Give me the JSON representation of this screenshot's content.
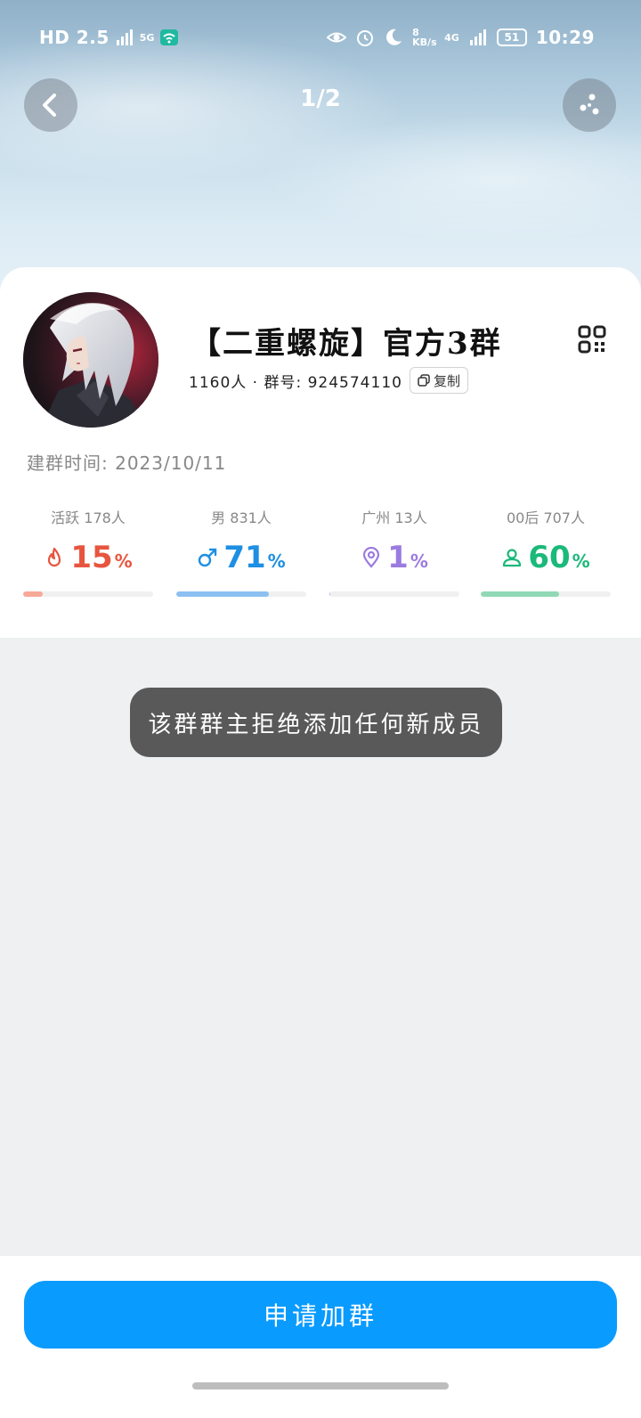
{
  "status_bar": {
    "left_text": "HD 2.5",
    "network_small": "5G",
    "speed": "8 KB/s",
    "signal_label": "4G",
    "battery_text": "51",
    "time": "10:29"
  },
  "nav": {
    "page_indicator": "1/2"
  },
  "group": {
    "name": "【二重螺旋】官方3群",
    "meta": "1160人 · 群号: 924574110",
    "copy_label": "复制",
    "created": "建群时间: 2023/10/11"
  },
  "stats": [
    {
      "label": "活跃 178人",
      "value": "15",
      "unit": "%",
      "color": "#e8553f",
      "fill_color": "#f7a898",
      "fraction": 0.15,
      "icon": "flame-icon"
    },
    {
      "label": "男 831人",
      "value": "71",
      "unit": "%",
      "color": "#1e8fe3",
      "fill_color": "#8cc0f2",
      "fraction": 0.71,
      "icon": "male-icon"
    },
    {
      "label": "广州 13人",
      "value": "1",
      "unit": "%",
      "color": "#9b7be0",
      "fill_color": "#c7b4ef",
      "fraction": 0.01,
      "icon": "location-icon"
    },
    {
      "label": "00后 707人",
      "value": "60",
      "unit": "%",
      "color": "#1bb97a",
      "fill_color": "#8fd9b6",
      "fraction": 0.6,
      "icon": "person-icon"
    }
  ],
  "toast": {
    "message": "该群群主拒绝添加任何新成员"
  },
  "bottom": {
    "apply_label": "申请加群"
  }
}
